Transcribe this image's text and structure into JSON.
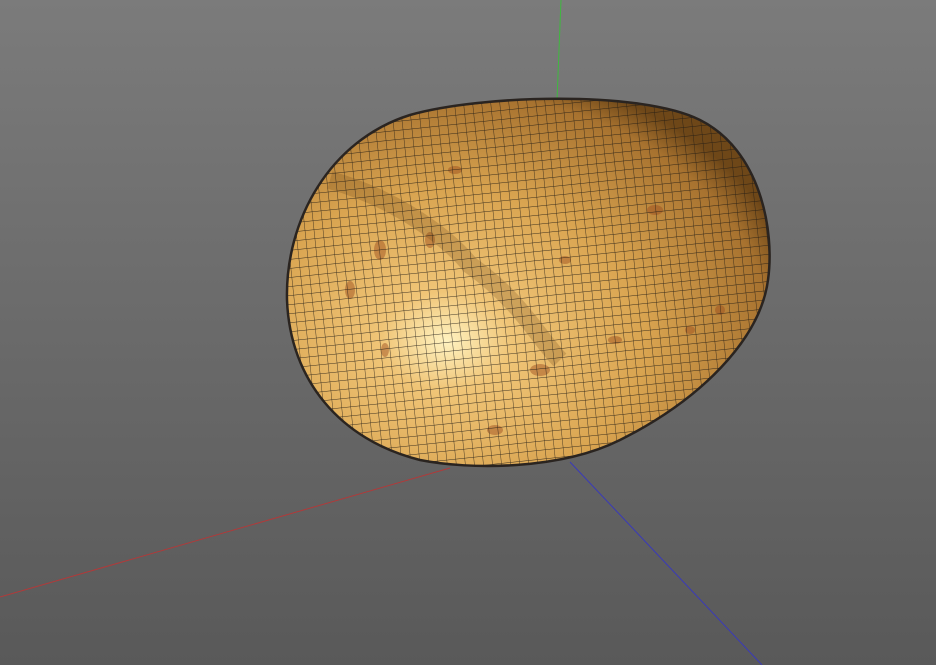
{
  "viewport": {
    "background_top": "#7b7b7b",
    "background_bottom": "#595959"
  },
  "axes": {
    "x_color": "#b03a3a",
    "y_color": "#3fb83f",
    "z_color": "#3a3ab8"
  },
  "model": {
    "icon": "potato-mesh",
    "base_color": "#d9a450",
    "highlight_color": "#fff2c0",
    "shadow_color": "#8a5a22",
    "wireframe_color": "#1e1a14"
  }
}
